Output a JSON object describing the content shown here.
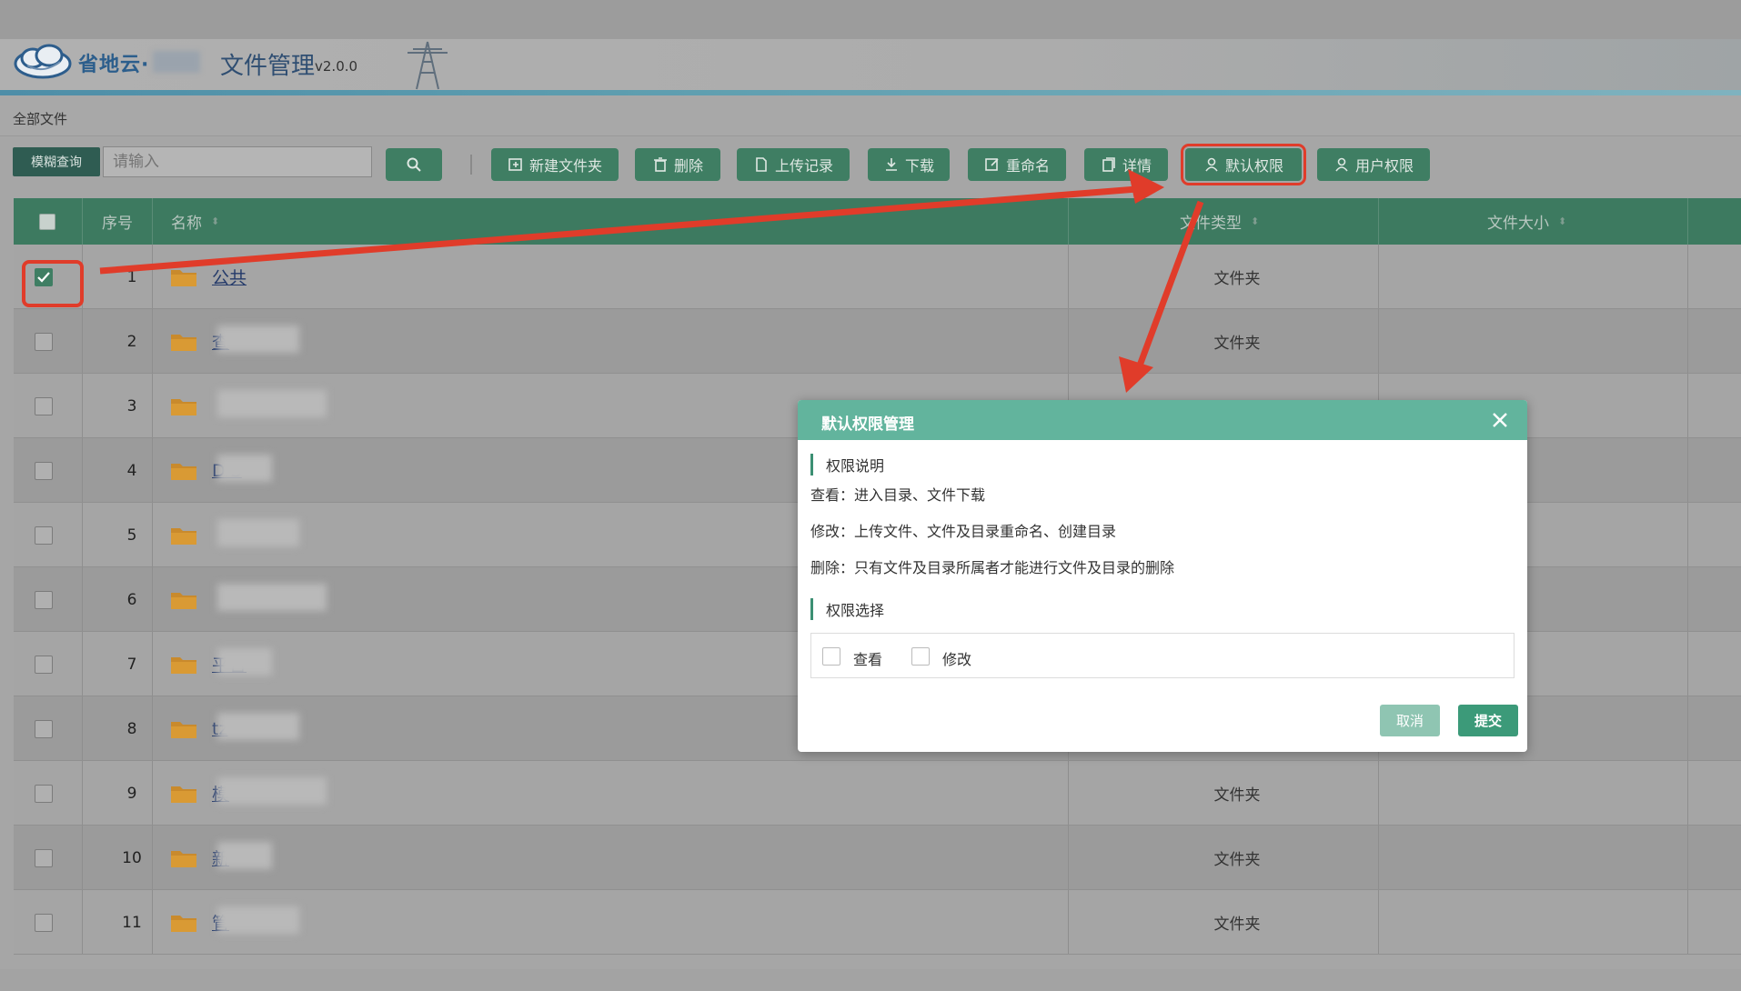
{
  "header": {
    "brand": "省地云·",
    "app_title": "文件管理",
    "app_version": "v2.0.0"
  },
  "breadcrumb": "全部文件",
  "search": {
    "label": "模糊查询",
    "placeholder": "请输入"
  },
  "toolbar": {
    "new_folder": "新建文件夹",
    "delete": "删除",
    "upload_log": "上传记录",
    "download": "下载",
    "rename": "重命名",
    "details": "详情",
    "default_perm": "默认权限",
    "user_perm": "用户权限"
  },
  "table": {
    "headers": {
      "index": "序号",
      "name": "名称",
      "type": "文件类型",
      "size": "文件大小"
    },
    "rows": [
      {
        "index": "1",
        "name": "公共",
        "type": "文件夹",
        "checked": true
      },
      {
        "index": "2",
        "name": "查",
        "type": "文件夹",
        "checked": false
      },
      {
        "index": "3",
        "name": "",
        "type": "",
        "checked": false
      },
      {
        "index": "4",
        "name": "D S",
        "type": "",
        "checked": false
      },
      {
        "index": "5",
        "name": "",
        "type": "",
        "checked": false
      },
      {
        "index": "6",
        "name": "",
        "type": "",
        "checked": false
      },
      {
        "index": "7",
        "name": "平台",
        "type": "",
        "checked": false
      },
      {
        "index": "8",
        "name": "tz",
        "type": "",
        "checked": false
      },
      {
        "index": "9",
        "name": "模",
        "type": "文件夹",
        "checked": false
      },
      {
        "index": "10",
        "name": "新",
        "type": "文件夹",
        "checked": false
      },
      {
        "index": "11",
        "name": "管",
        "type": "文件夹",
        "checked": false
      }
    ]
  },
  "modal": {
    "title": "默认权限管理",
    "section_desc": "权限说明",
    "desc_view": "查看：进入目录、文件下载",
    "desc_modify": "修改：上传文件、文件及目录重命名、创建目录",
    "desc_delete": "删除：只有文件及目录所属者才能进行文件及目录的删除",
    "section_select": "权限选择",
    "opt_view": "查看",
    "opt_modify": "修改",
    "cancel": "取消",
    "submit": "提交"
  },
  "colors": {
    "primary": "#3f7e63",
    "modal_header": "#62b49d",
    "annotation": "#e03c2a"
  }
}
